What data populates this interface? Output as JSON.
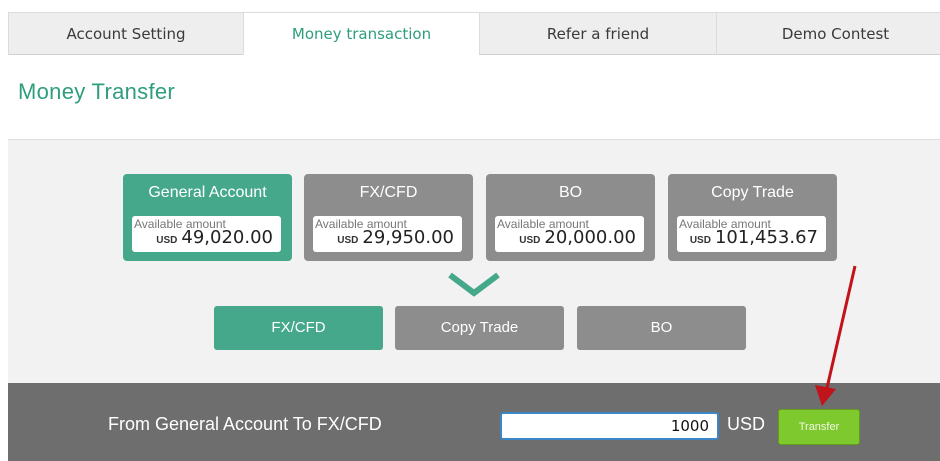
{
  "tabs": [
    {
      "label": "Account Setting",
      "active": false
    },
    {
      "label": "Money transaction",
      "active": true
    },
    {
      "label": "Refer a friend",
      "active": false
    },
    {
      "label": "Demo Contest",
      "active": false
    }
  ],
  "page_title": "Money Transfer",
  "source_accounts": [
    {
      "name": "General Account",
      "available_label": "Available amount",
      "currency": "USD",
      "amount": "49,020.00",
      "selected": true
    },
    {
      "name": "FX/CFD",
      "available_label": "Available amount",
      "currency": "USD",
      "amount": "29,950.00",
      "selected": false
    },
    {
      "name": "BO",
      "available_label": "Available amount",
      "currency": "USD",
      "amount": "20,000.00",
      "selected": false
    },
    {
      "name": "Copy Trade",
      "available_label": "Available amount",
      "currency": "USD",
      "amount": "101,453.67",
      "selected": false
    }
  ],
  "icons": {
    "selector": "chevron-down-icon",
    "annotation": "red-arrow-icon"
  },
  "destination_accounts": [
    {
      "name": "FX/CFD",
      "selected": true
    },
    {
      "name": "Copy Trade",
      "selected": false
    },
    {
      "name": "BO",
      "selected": false
    }
  ],
  "transfer_bar": {
    "summary": "From General Account To FX/CFD",
    "amount_value": "1000",
    "currency": "USD",
    "button_label": "Transfer"
  },
  "colors": {
    "accent": "#45a88a",
    "title": "#2f9d7e",
    "inactive": "#8d8d8d",
    "bar": "#6e6e6e",
    "button": "#7dc92e",
    "annotation": "#c0141a"
  }
}
